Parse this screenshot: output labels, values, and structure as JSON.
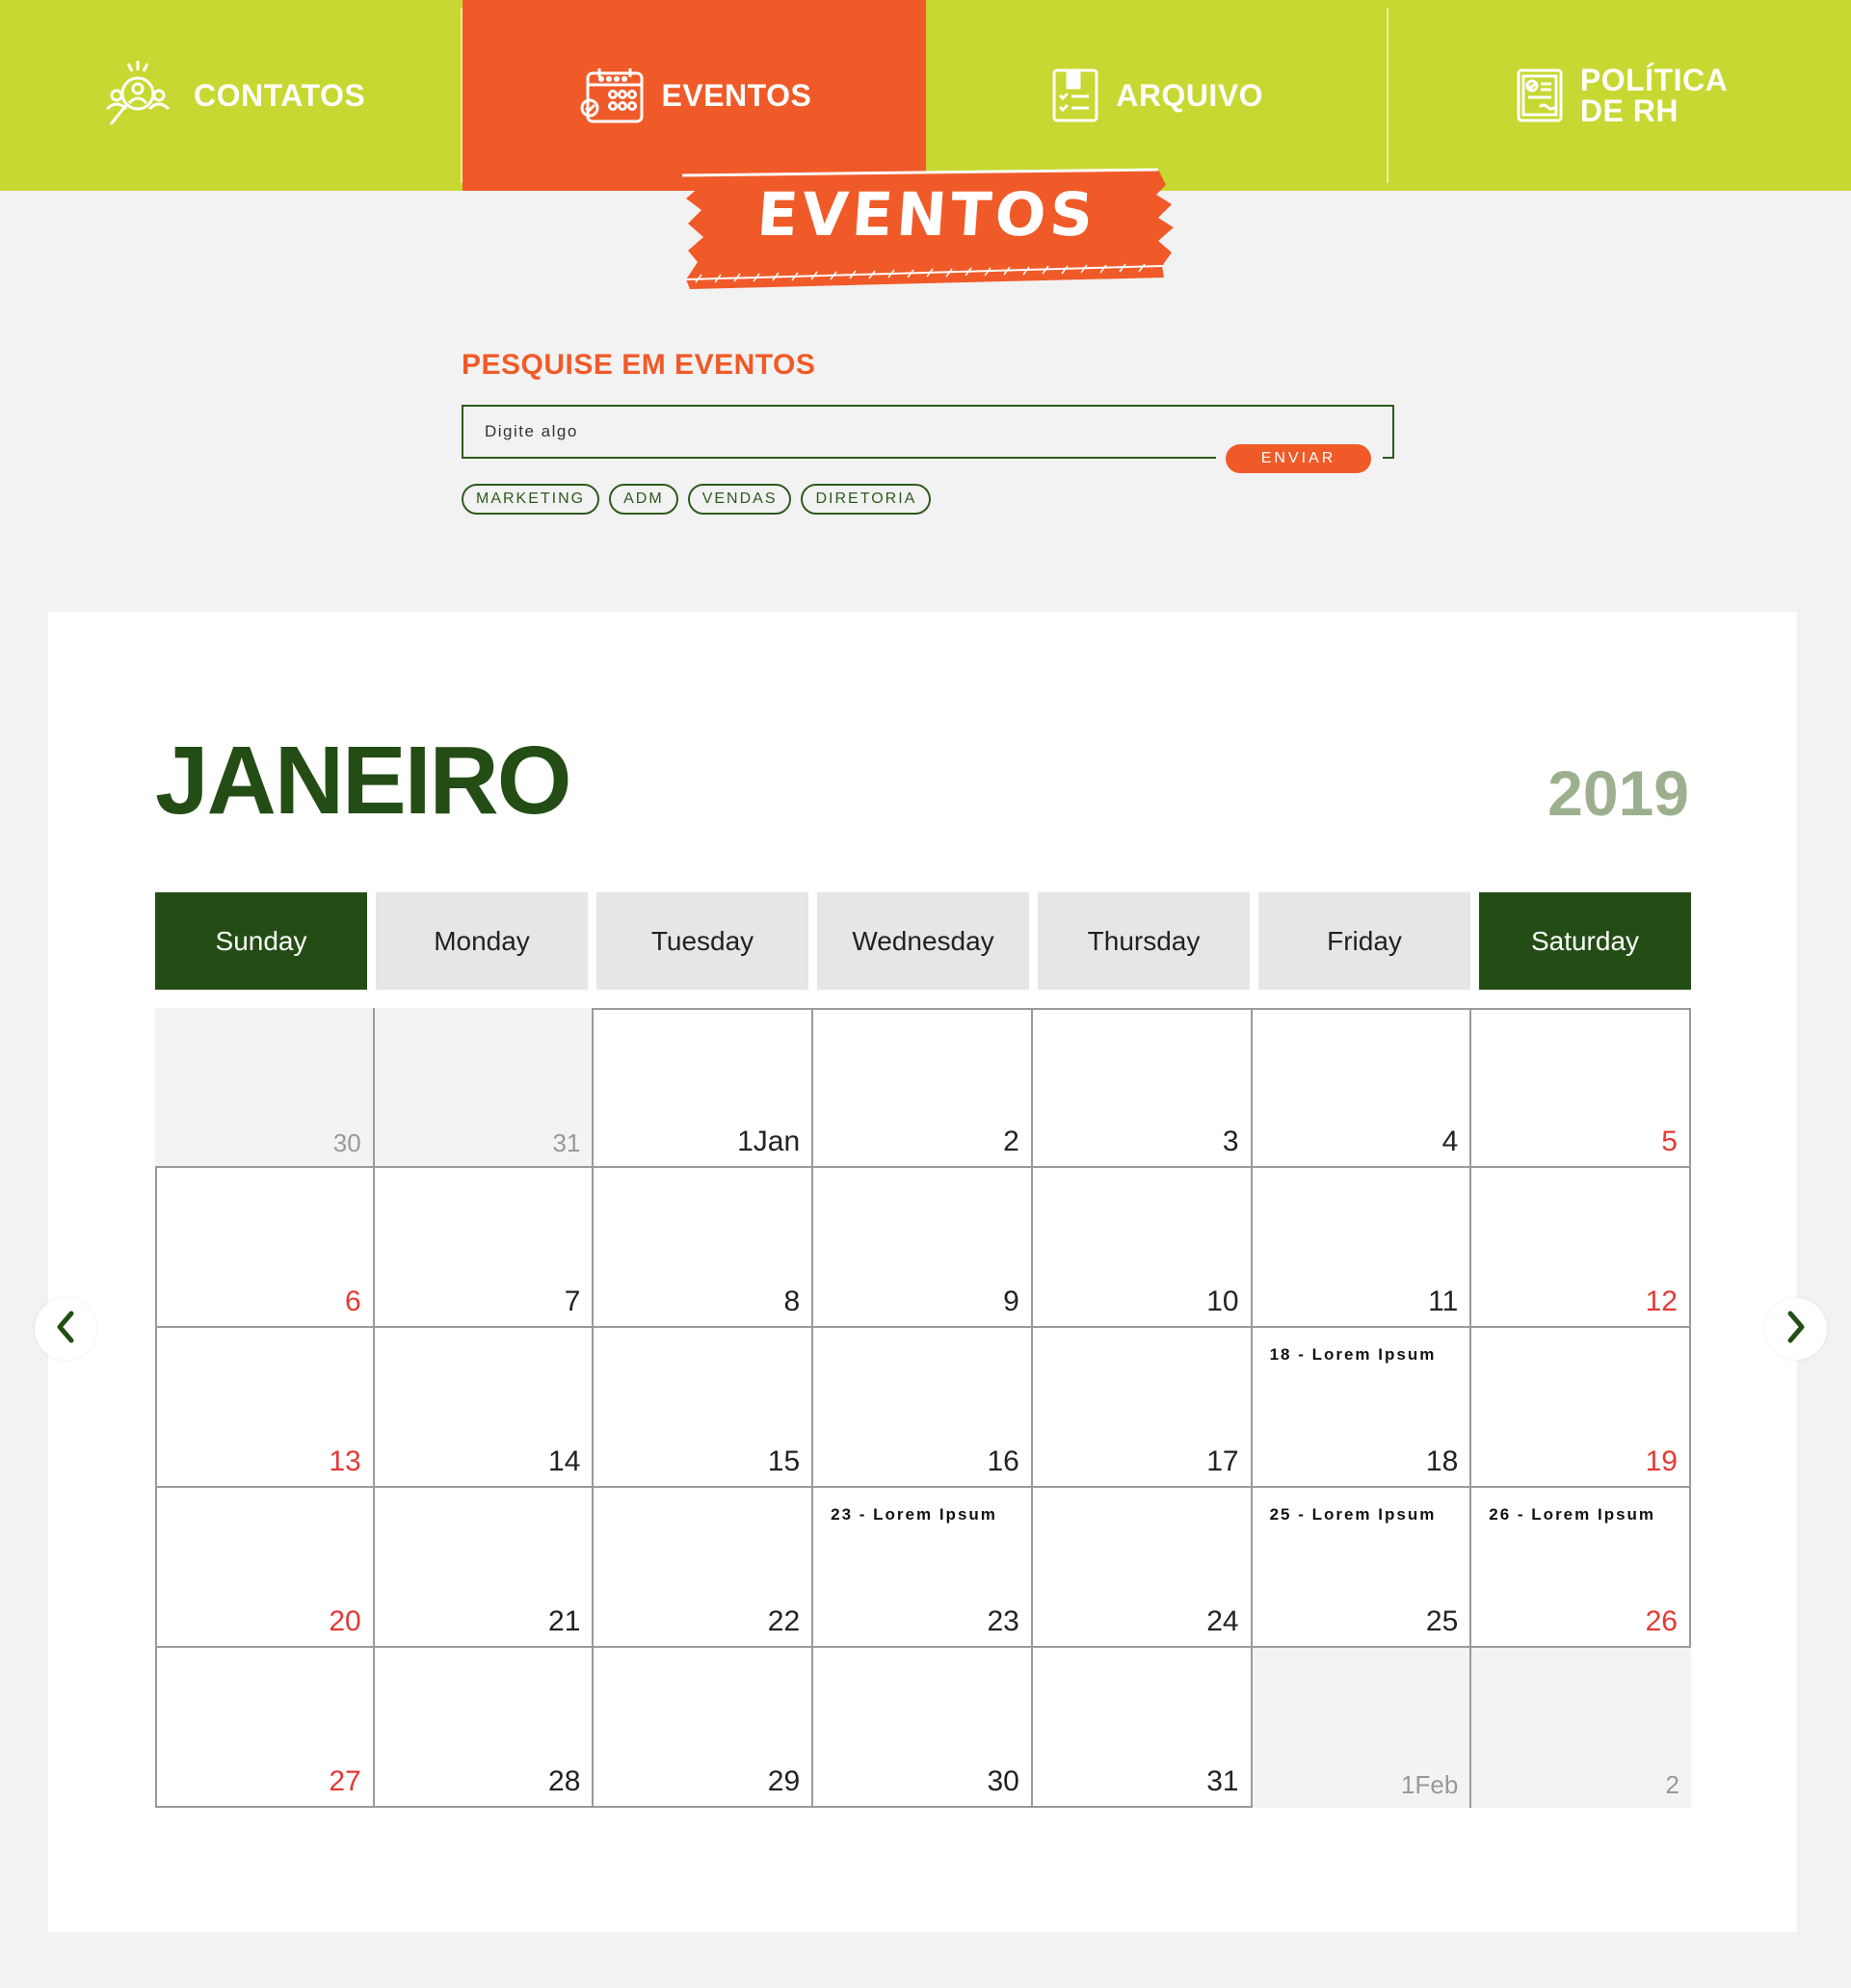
{
  "nav": {
    "items": [
      {
        "label": "CONTATOS",
        "icon": "contacts-icon",
        "active": false
      },
      {
        "label": "EVENTOS",
        "icon": "calendar-icon",
        "active": true
      },
      {
        "label": "ARQUIVO",
        "icon": "archive-icon",
        "active": false
      },
      {
        "label": "POLÍTICA DE RH",
        "line1": "POLÍTICA",
        "line2": "DE RH",
        "icon": "policy-document-icon",
        "active": false
      }
    ]
  },
  "banner": {
    "text": "EVENTOS"
  },
  "search": {
    "title": "PESQUISE EM EVENTOS",
    "placeholder": "Digite algo",
    "submit_label": "ENVIAR",
    "tags": [
      "MARKETING",
      "ADM",
      "VENDAS",
      "DIRETORIA"
    ]
  },
  "calendar": {
    "month": "JANEIRO",
    "year": "2019",
    "weekdays": [
      "Sunday",
      "Monday",
      "Tuesday",
      "Wednesday",
      "Thursday",
      "Friday",
      "Saturday"
    ],
    "weeks": [
      [
        {
          "d": "30",
          "out": true
        },
        {
          "d": "31",
          "out": true
        },
        {
          "d": "1Jan"
        },
        {
          "d": "2"
        },
        {
          "d": "3"
        },
        {
          "d": "4"
        },
        {
          "d": "5"
        }
      ],
      [
        {
          "d": "6"
        },
        {
          "d": "7"
        },
        {
          "d": "8"
        },
        {
          "d": "9"
        },
        {
          "d": "10"
        },
        {
          "d": "11"
        },
        {
          "d": "12"
        }
      ],
      [
        {
          "d": "13"
        },
        {
          "d": "14"
        },
        {
          "d": "15"
        },
        {
          "d": "16"
        },
        {
          "d": "17"
        },
        {
          "d": "18",
          "event": "18  -  Lorem Ipsum"
        },
        {
          "d": "19"
        }
      ],
      [
        {
          "d": "20"
        },
        {
          "d": "21"
        },
        {
          "d": "22"
        },
        {
          "d": "23",
          "event": "23  -  Lorem Ipsum"
        },
        {
          "d": "24"
        },
        {
          "d": "25",
          "event": "25  -  Lorem Ipsum"
        },
        {
          "d": "26",
          "event": "26  -  Lorem Ipsum"
        }
      ],
      [
        {
          "d": "27"
        },
        {
          "d": "28"
        },
        {
          "d": "29"
        },
        {
          "d": "30"
        },
        {
          "d": "31"
        },
        {
          "d": "1Feb",
          "out": true
        },
        {
          "d": "2",
          "out": true
        }
      ]
    ],
    "prev_icon": "chevron-left-icon",
    "next_icon": "chevron-right-icon"
  },
  "colors": {
    "lime": "#c6d831",
    "orange": "#f05a28",
    "dark_green": "#244d15",
    "muted_green": "#9db08e",
    "weekend_red": "#e53935"
  }
}
